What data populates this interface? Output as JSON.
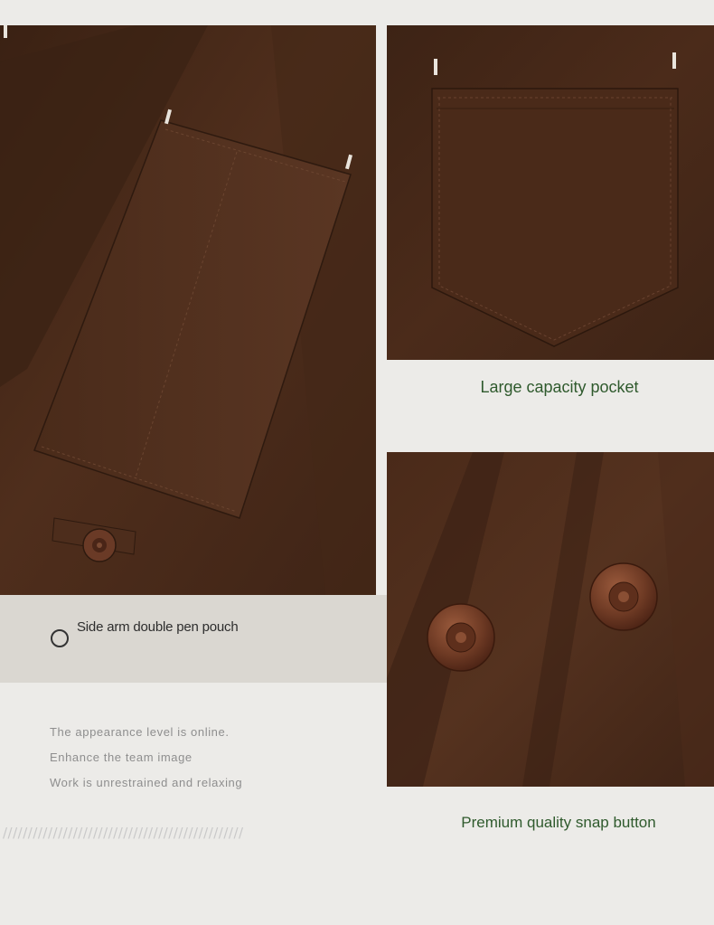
{
  "left": {
    "caption": "Side arm double pen pouch",
    "description": [
      "The appearance level is online.",
      "Enhance the team image",
      "Work is unrestrained and relaxing"
    ],
    "divider": "////////////////////////////////////////////////"
  },
  "right_top": {
    "caption": "Large capacity pocket"
  },
  "right_bottom": {
    "caption": "Premium quality snap button"
  },
  "colors": {
    "background": "#ecebe8",
    "band": "#dad7d1",
    "fabric": "#4c2c1b",
    "caption_green": "#2f5a2d"
  }
}
